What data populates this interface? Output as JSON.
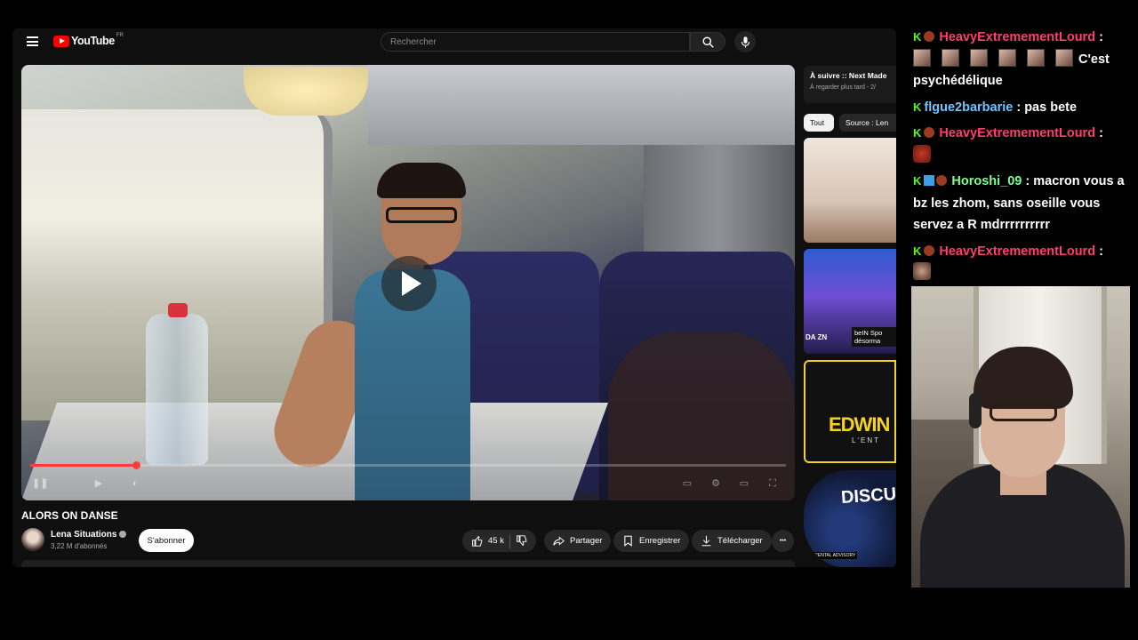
{
  "youtube": {
    "logo_text": "YouTube",
    "logo_country": "FR",
    "search_placeholder": "Rechercher",
    "video": {
      "title": "ALORS ON DANSE",
      "progress_fraction": 0.14
    },
    "channel": {
      "name": "Lena Situations",
      "subscribers": "3,22 M d'abonnés",
      "subscribe_label": "S'abonner"
    },
    "actions": {
      "likes": "45 k",
      "share": "Partager",
      "save": "Enregistrer",
      "download": "Télécharger",
      "more": "•••"
    },
    "sidebar": {
      "next_title": "À suivre :: Next Made",
      "next_sub": "À regarder plus tard - 2/",
      "chips": [
        "Tout",
        "Source : Len"
      ],
      "thumb2_badge": "beIN Spo désorma",
      "thumb2_brand": "DA ZN",
      "thumb3_text": "EDWIN",
      "thumb3_sub": "L'ENT",
      "thumb4_text": "DISCU",
      "thumb4_label": "PARENTAL ADVISORY"
    }
  },
  "chat": [
    {
      "user": "HeavyExtremementLourd",
      "color": "red",
      "badges": [
        "kick",
        "round"
      ],
      "text": "C'est psychédélique",
      "emotes": 6
    },
    {
      "user": "flgue2barbarie",
      "color": "blue",
      "badges": [
        "kick"
      ],
      "text": "pas bete",
      "emotes": 0
    },
    {
      "user": "HeavyExtremementLourd",
      "color": "red",
      "badges": [
        "kick",
        "round"
      ],
      "text": "",
      "emotes": 0,
      "emote_round": true
    },
    {
      "user": "Horoshi_09",
      "color": "green",
      "badges": [
        "kick",
        "square",
        "round"
      ],
      "text": "macron vous a bz les zhom, sans oseille vous servez a R mdrrrrrrrrrr",
      "emotes": 0
    },
    {
      "user": "HeavyExtremementLourd",
      "color": "red",
      "badges": [
        "kick",
        "round"
      ],
      "text": "",
      "emotes": 0,
      "emote_face": true
    }
  ],
  "colors": {
    "youtube_red": "#ff0000",
    "chat_red": "#ff3d6e",
    "chat_blue": "#6ec6ff",
    "chat_green": "#7bff8e",
    "kick_green": "#53fc18"
  }
}
